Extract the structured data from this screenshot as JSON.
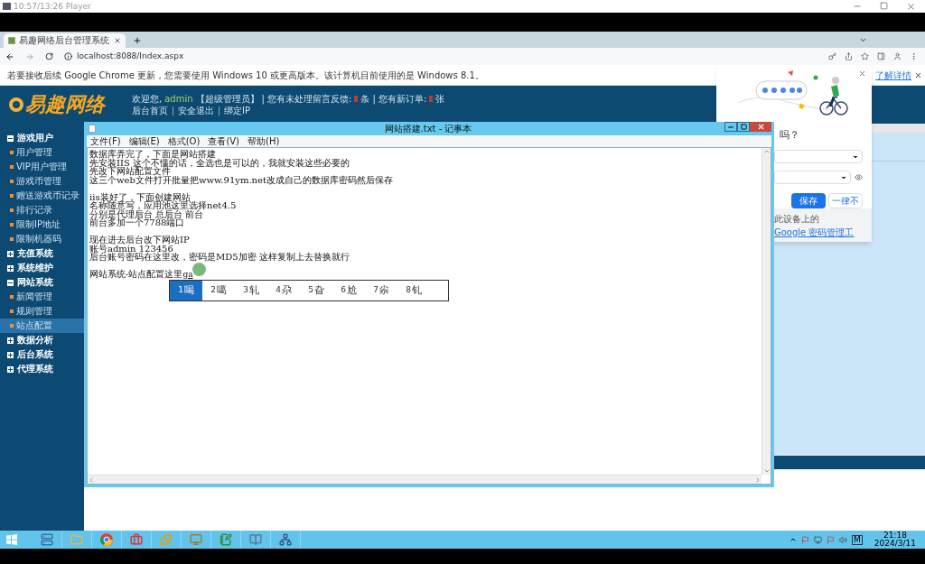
{
  "player": {
    "title": "10:57/13:26 Player"
  },
  "browser": {
    "tab": {
      "title": "易趣网络后台管理系统"
    },
    "address": "localhost:8088/Index.aspx",
    "infobar": {
      "message": "若要接收后续 Google Chrome 更新，您需要使用 Windows 10 或更高版本。该计算机目前使用的是 Windows 8.1。",
      "link": "了解详情"
    }
  },
  "site": {
    "logo": "易趣网络",
    "header": {
      "welcome": "欢迎您,",
      "user": "admin",
      "role": "【超级管理员】",
      "feedback_label": "| 您有未处理留言反馈:",
      "feedback_unit": "条",
      "orders_label": "| 您有新订单:",
      "orders_unit": "张",
      "links": [
        "后台首页",
        "安全退出",
        "绑定IP"
      ]
    },
    "sidebar": [
      {
        "label": "游戏用户",
        "expanded": true,
        "children": [
          {
            "label": "用户管理",
            "selected": false
          },
          {
            "label": "VIP用户管理",
            "selected": false
          },
          {
            "label": "游戏币管理",
            "selected": false
          },
          {
            "label": "赠送游戏币记录",
            "selected": false
          },
          {
            "label": "排行记录",
            "selected": false
          },
          {
            "label": "限制IP地址",
            "selected": false
          },
          {
            "label": "限制机器码",
            "selected": false
          }
        ]
      },
      {
        "label": "充值系统",
        "expanded": false
      },
      {
        "label": "系统维护",
        "expanded": false
      },
      {
        "label": "网站系统",
        "expanded": true,
        "children": [
          {
            "label": "新闻管理",
            "selected": false
          },
          {
            "label": "规则管理",
            "selected": false
          },
          {
            "label": "站点配置",
            "selected": true
          }
        ]
      },
      {
        "label": "数据分析",
        "expanded": false
      },
      {
        "label": "后台系统",
        "expanded": false
      },
      {
        "label": "代理系统",
        "expanded": false
      }
    ]
  },
  "notepad": {
    "title": "网站搭建.txt - 记事本",
    "menu": [
      "文件(F)",
      "编辑(E)",
      "格式(O)",
      "查看(V)",
      "帮助(H)"
    ],
    "blocks": [
      [
        "数据库弄完了，下面是网站搭建",
        "先安装IIS 这个不懂的话，全选也是可以的，我就安装这些必要的",
        "先改下网站配置文件",
        "这三个web文件打开批量把www.91ym.net改成自己的数据库密码然后保存"
      ],
      [
        "iis装好了，下面创建网站",
        "名称随意写，应用池这里选择net4.5",
        "分别是代理后台 总后台 前台",
        "前台多加一个7788端口"
      ],
      [
        "现在进去后台改下网站IP",
        "账号admin   123456",
        "后台账号密码在这里改，密码是MD5加密 这样复制上去替换就行"
      ]
    ],
    "last_line": {
      "text": "网站系统-站点配置这里",
      "composition": "ga"
    }
  },
  "ime": {
    "candidates": [
      {
        "number": "1",
        "text": "喝",
        "selected": true
      },
      {
        "number": "2",
        "text": "噶",
        "selected": false
      },
      {
        "number": "3",
        "text": "轧",
        "selected": false
      },
      {
        "number": "4",
        "text": "尕",
        "selected": false
      },
      {
        "number": "5",
        "text": "旮",
        "selected": false
      },
      {
        "number": "6",
        "text": "尬",
        "selected": false
      },
      {
        "number": "7",
        "text": "尜",
        "selected": false
      },
      {
        "number": "8",
        "text": "钆",
        "selected": false
      }
    ]
  },
  "password_popup": {
    "question": "吗？",
    "buttons": [
      {
        "label": "保存",
        "kind": "primary"
      },
      {
        "label": "一律不",
        "kind": "secondary"
      }
    ],
    "footer_text": "此设备上的",
    "footer_link": "Google 密码管理工"
  },
  "taskbar": {
    "tray_label": "M",
    "time": "21:18",
    "date": "2024/3/11"
  }
}
